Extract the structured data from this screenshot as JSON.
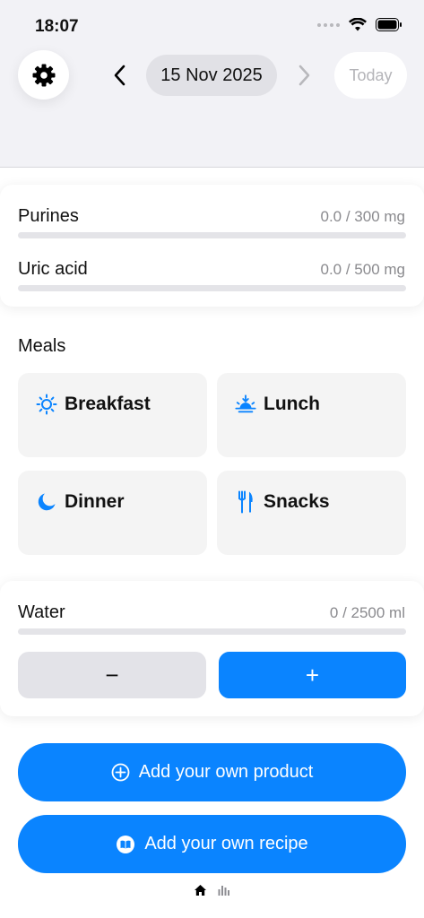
{
  "status_bar": {
    "time": "18:07"
  },
  "header": {
    "date": "15 Nov 2025",
    "today_label": "Today"
  },
  "nutrients": [
    {
      "label": "Purines",
      "value_text": "0.0 / 300 mg",
      "progress": 0
    },
    {
      "label": "Uric acid",
      "value_text": "0.0 / 500 mg",
      "progress": 0
    }
  ],
  "meals": {
    "title": "Meals",
    "items": [
      {
        "label": "Breakfast",
        "icon": "sun-icon"
      },
      {
        "label": "Lunch",
        "icon": "sunrise-icon"
      },
      {
        "label": "Dinner",
        "icon": "moon-icon"
      },
      {
        "label": "Snacks",
        "icon": "fork-knife-icon"
      }
    ]
  },
  "water": {
    "label": "Water",
    "value_text": "0 / 2500 ml",
    "progress": 0,
    "decrement_label": "−",
    "increment_label": "+"
  },
  "actions": {
    "add_product_label": "Add your own product",
    "add_recipe_label": "Add your own recipe"
  },
  "colors": {
    "accent": "#0a84ff",
    "background": "#ffffff",
    "header_bg": "#f2f2f6",
    "tile_bg": "#f4f4f4"
  }
}
